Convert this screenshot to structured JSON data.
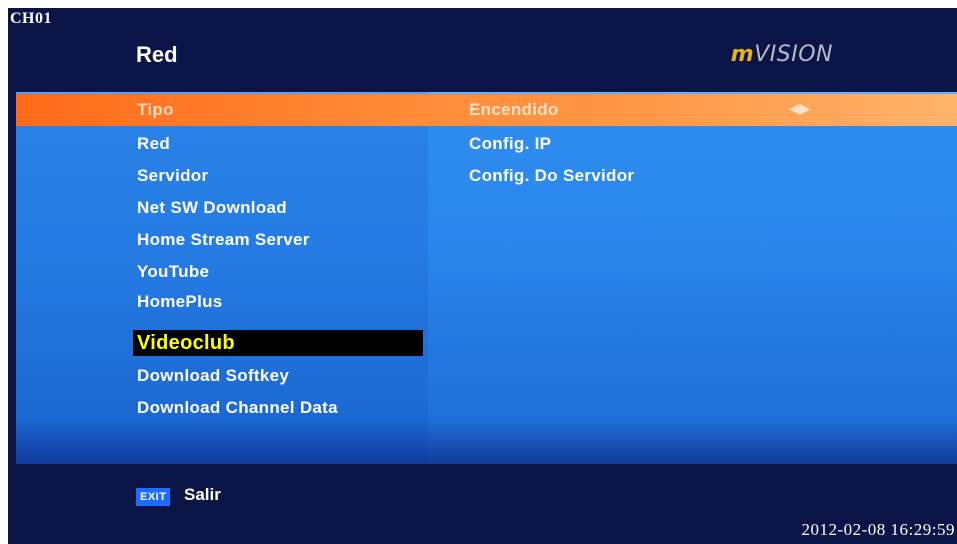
{
  "channel": "CH01",
  "header": {
    "title": "Red",
    "brand_prefix": "m",
    "brand_rest": "VISION"
  },
  "menu": [
    {
      "label": "Tipo",
      "value": "Encendido",
      "arrows": "◀▶"
    },
    {
      "label": "Red",
      "value": "Config. IP"
    },
    {
      "label": "Servidor",
      "value": "Config. Do Servidor"
    },
    {
      "label": "Net SW Download",
      "value": ""
    },
    {
      "label": "Home Stream Server",
      "value": ""
    },
    {
      "label": "YouTube",
      "value": ""
    },
    {
      "label": "HomePlus",
      "value": ""
    },
    {
      "label": "Videoclub",
      "value": ""
    },
    {
      "label": "Download Softkey",
      "value": ""
    },
    {
      "label": "Download Channel Data",
      "value": ""
    }
  ],
  "footer": {
    "exit_key": "EXIT",
    "exit_label": "Salir",
    "datetime": "2012-02-08 16:29:59"
  }
}
